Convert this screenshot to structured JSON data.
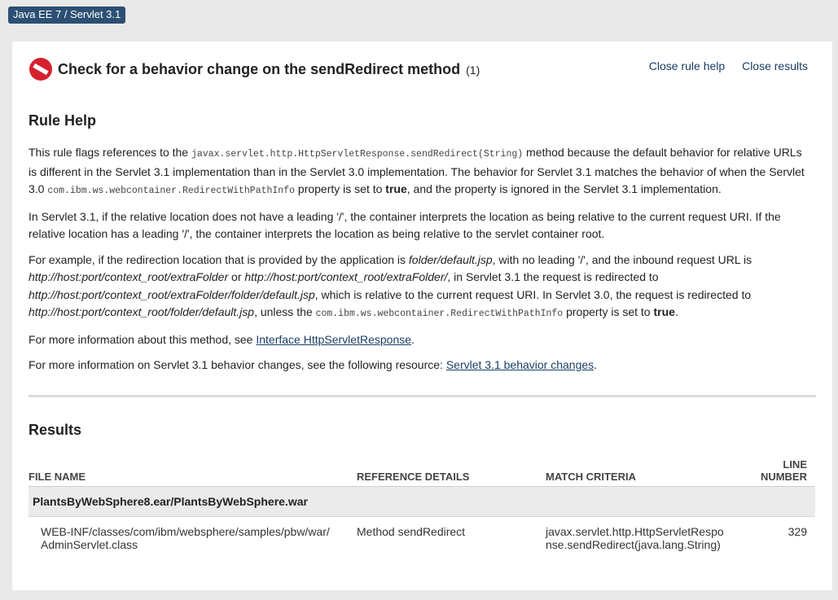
{
  "badge": "Java EE 7 / Servlet 3.1",
  "header": {
    "title": "Check for a behavior change on the sendRedirect method",
    "count": "(1)",
    "close_rule_help": "Close rule help",
    "close_results": "Close results"
  },
  "rule_help": {
    "heading": "Rule Help",
    "p1": {
      "a": "This rule flags references to the ",
      "code1": "javax.servlet.http.HttpServletResponse.sendRedirect(String)",
      "b": " method because the default behavior for relative URLs is different in the Servlet 3.1 implementation than in the Servlet 3.0 implementation. The behavior for Servlet 3.1 matches the behavior of when the Servlet 3.0 ",
      "code2": "com.ibm.ws.webcontainer.RedirectWithPathInfo",
      "c": " property is set to ",
      "bold": "true",
      "d": ", and the property is ignored in the Servlet 3.1 implementation."
    },
    "p2": "In Servlet 3.1, if the relative location does not have a leading '/', the container interprets the location as being relative to the current request URI. If the relative location has a leading '/', the container interprets the location as being relative to the servlet container root.",
    "p3": {
      "a": "For example, if the redirection location that is provided by the application is ",
      "i1": "folder/default.jsp",
      "b": ", with no leading '/', and the inbound request URL is ",
      "i2": "http://host:port/context_root/extraFolder",
      "c": " or ",
      "i3": "http://host:port/context_root/extraFolder/",
      "d": ", in Servlet 3.1 the request is redirected to ",
      "i4": "http://host:port/context_root/extraFolder/folder/default.jsp",
      "e": ", which is relative to the current request URI. In Servlet 3.0, the request is redirected to ",
      "i5": "http://host:port/context_root/folder/default.jsp",
      "f": ", unless the ",
      "code": "com.ibm.ws.webcontainer.RedirectWithPathInfo",
      "g": " property is set to ",
      "bold": "true",
      "h": "."
    },
    "p4": {
      "a": "For more information about this method, see ",
      "link": "Interface HttpServletResponse",
      "b": "."
    },
    "p5": {
      "a": "For more information on Servlet 3.1 behavior changes, see the following resource: ",
      "link": "Servlet 3.1 behavior changes",
      "b": "."
    }
  },
  "results": {
    "heading": "Results",
    "columns": {
      "file_name": "FILE NAME",
      "reference_details": "REFERENCE DETAILS",
      "match_criteria": "MATCH CRITERIA",
      "line_number_1": "LINE",
      "line_number_2": "NUMBER"
    },
    "group": "PlantsByWebSphere8.ear/PlantsByWebSphere.war",
    "rows": [
      {
        "file": "WEB-INF/classes/com/ibm/websphere/samples/pbw/war/AdminServlet.class",
        "reference": "Method sendRedirect",
        "criteria": "javax.servlet.http.HttpServletResponse.sendRedirect(java.lang.String)",
        "line": "329"
      }
    ]
  },
  "colors": {
    "badge_bg": "#2c4f73",
    "link": "#1a3e66",
    "no_icon": "#d6202e"
  }
}
